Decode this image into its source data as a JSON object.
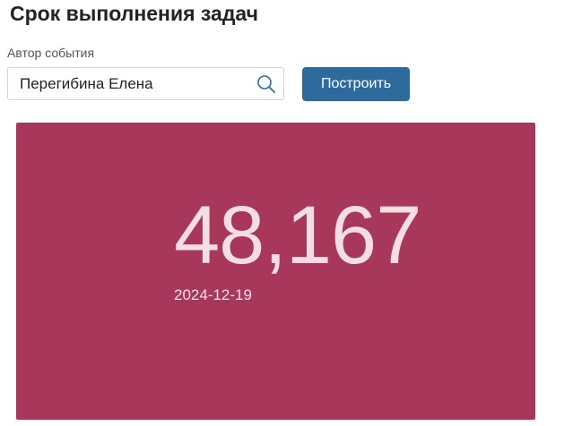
{
  "page": {
    "title": "Срок выполнения задач"
  },
  "filter": {
    "label": "Автор события",
    "value": "Перегибина Елена",
    "search_icon": "search-icon"
  },
  "actions": {
    "build_label": "Построить"
  },
  "metric": {
    "value": "48,167",
    "date": "2024-12-19"
  },
  "colors": {
    "card_background": "#a7385c",
    "card_text": "#f5dde4",
    "button_background": "#2e6a9e"
  }
}
